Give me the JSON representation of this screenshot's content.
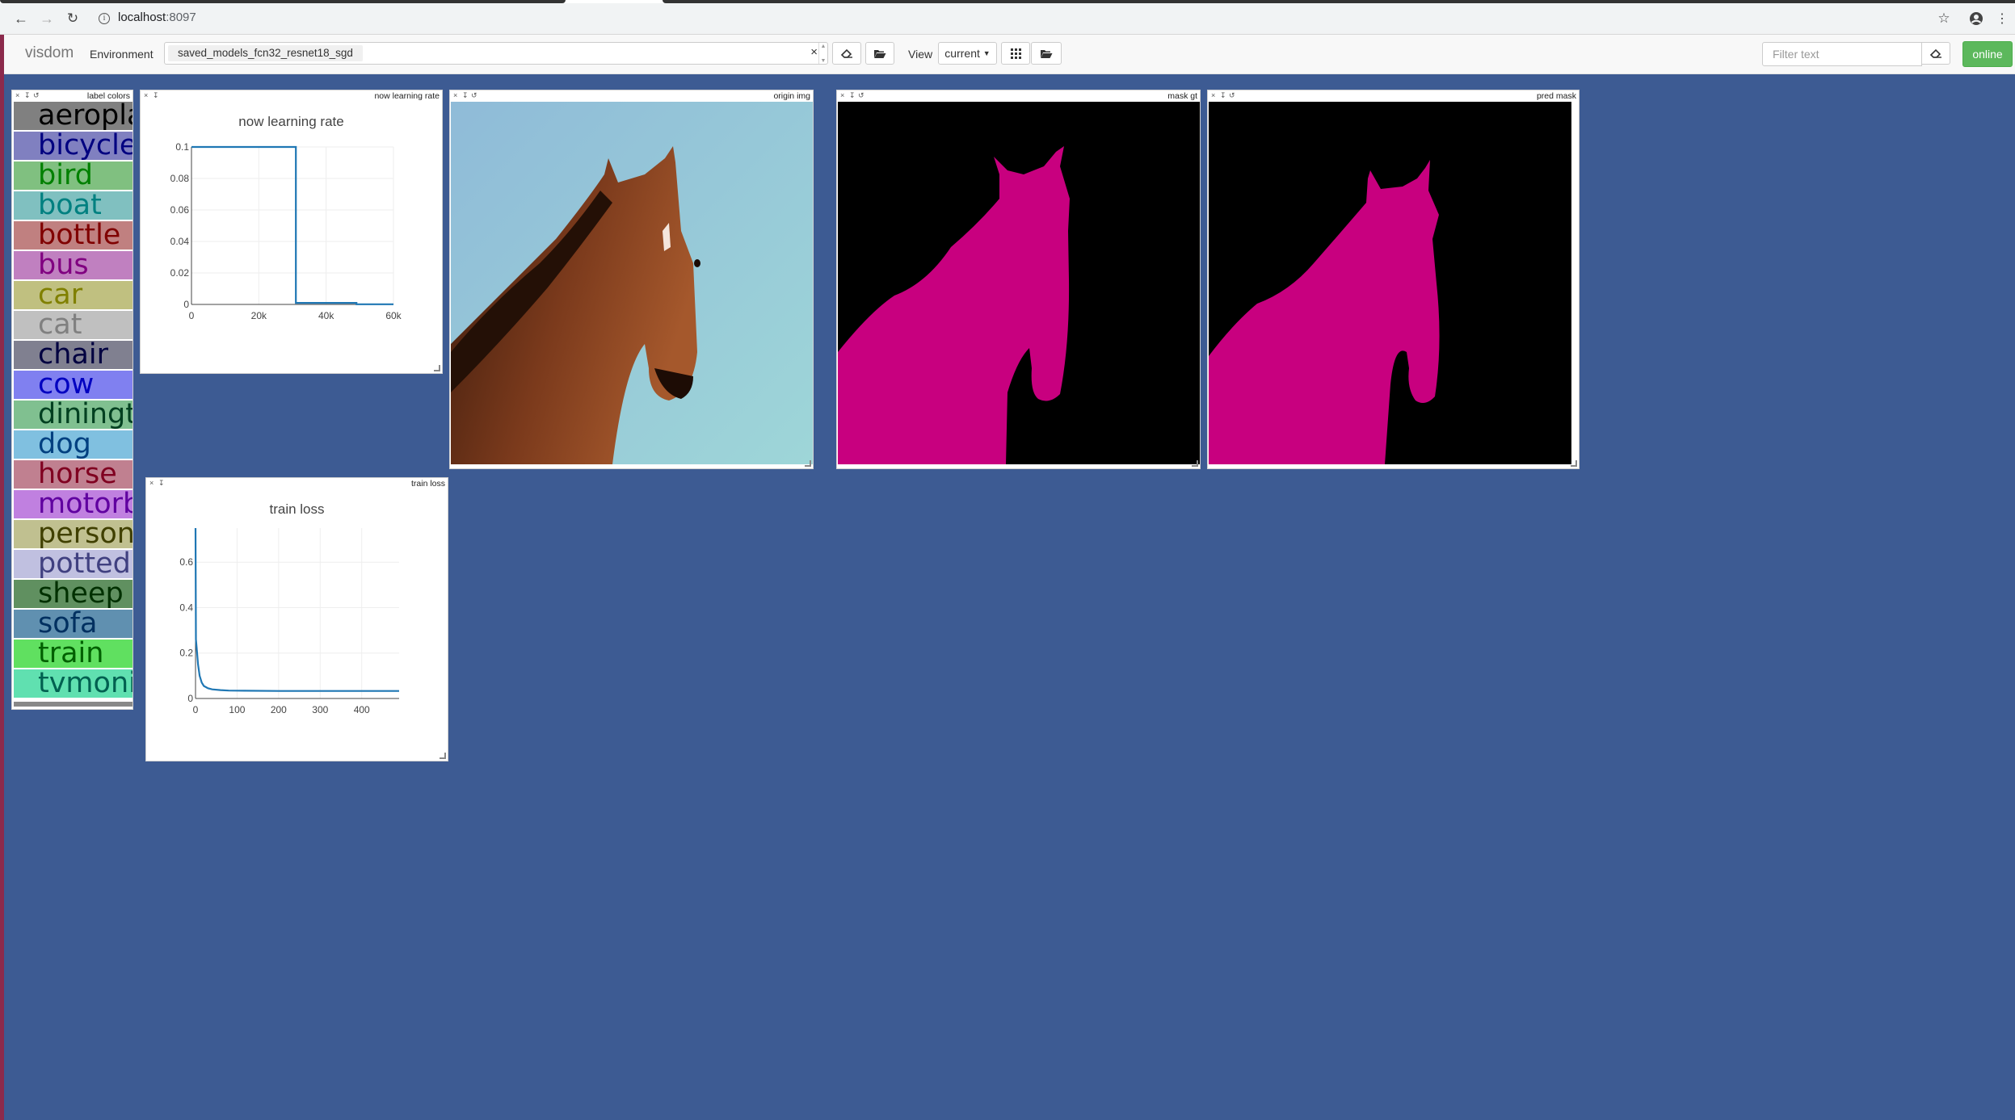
{
  "browser": {
    "url_host": "localhost",
    "url_port": ":8097"
  },
  "navbar": {
    "brand": "visdom",
    "environment_label": "Environment",
    "environment_value": "saved_models_fcn32_resnet18_sgd",
    "environment_clear": "×",
    "view_label": "View",
    "view_value": "current",
    "filter_placeholder": "Filter text",
    "status": "online"
  },
  "panes": {
    "label_colors": {
      "title": "label colors",
      "items": [
        {
          "label": "aeroplane",
          "bg": "#808080",
          "fg": "#000000"
        },
        {
          "label": "bicycle",
          "bg": "#8080c0",
          "fg": "#000080"
        },
        {
          "label": "bird",
          "bg": "#80c080",
          "fg": "#008000"
        },
        {
          "label": "boat",
          "bg": "#80c0c0",
          "fg": "#008080"
        },
        {
          "label": "bottle",
          "bg": "#c08080",
          "fg": "#800000"
        },
        {
          "label": "bus",
          "bg": "#c080c0",
          "fg": "#800080"
        },
        {
          "label": "car",
          "bg": "#c0c080",
          "fg": "#808000"
        },
        {
          "label": "cat",
          "bg": "#c0c0c0",
          "fg": "#808080"
        },
        {
          "label": "chair",
          "bg": "#808090",
          "fg": "#000040"
        },
        {
          "label": "cow",
          "bg": "#8080f0",
          "fg": "#0000c0"
        },
        {
          "label": "diningtable",
          "bg": "#80c090",
          "fg": "#004020"
        },
        {
          "label": "dog",
          "bg": "#80c0e0",
          "fg": "#004080"
        },
        {
          "label": "horse",
          "bg": "#c08090",
          "fg": "#800020"
        },
        {
          "label": "motorbike",
          "bg": "#c080e0",
          "fg": "#6000a0"
        },
        {
          "label": "person",
          "bg": "#c0c090",
          "fg": "#404000"
        },
        {
          "label": "pottedplant",
          "bg": "#c0c0e0",
          "fg": "#404080"
        },
        {
          "label": "sheep",
          "bg": "#609060",
          "fg": "#003000"
        },
        {
          "label": "sofa",
          "bg": "#6090b0",
          "fg": "#003060"
        },
        {
          "label": "train",
          "bg": "#60e060",
          "fg": "#006000"
        },
        {
          "label": "tvmonitor",
          "bg": "#60e0b0",
          "fg": "#006050"
        }
      ]
    },
    "learning_rate": {
      "title": "now learning rate",
      "plot_title": "now learning rate"
    },
    "origin_img": {
      "title": "origin img"
    },
    "mask_gt": {
      "title": "mask gt"
    },
    "pred_mask": {
      "title": "pred mask"
    },
    "train_loss": {
      "title": "train loss",
      "plot_title": "train loss"
    }
  },
  "chart_data": [
    {
      "type": "line",
      "title": "now learning rate",
      "xlabel": "",
      "ylabel": "",
      "xlim": [
        0,
        60000
      ],
      "ylim": [
        0,
        0.1
      ],
      "x_ticks": [
        "0",
        "20k",
        "40k",
        "60k"
      ],
      "y_ticks": [
        "0",
        "0.02",
        "0.04",
        "0.06",
        "0.08",
        "0.1"
      ],
      "grid": true,
      "series": [
        {
          "x": [
            0,
            31000,
            31000,
            49000,
            49000,
            60000
          ],
          "y": [
            0.1,
            0.1,
            0.001,
            0.001,
            0.0001,
            0.0001
          ]
        }
      ]
    },
    {
      "type": "line",
      "title": "train loss",
      "xlabel": "",
      "ylabel": "",
      "xlim": [
        0,
        490
      ],
      "ylim": [
        0,
        0.75
      ],
      "x_ticks": [
        "0",
        "100",
        "200",
        "300",
        "400"
      ],
      "y_ticks": [
        "0",
        "0.2",
        "0.4",
        "0.6"
      ],
      "grid": true,
      "series": [
        {
          "x": [
            0,
            1,
            3,
            6,
            10,
            15,
            20,
            30,
            40,
            60,
            80,
            120,
            200,
            300,
            400,
            490
          ],
          "y": [
            0.75,
            0.26,
            0.22,
            0.15,
            0.1,
            0.07,
            0.055,
            0.045,
            0.04,
            0.037,
            0.035,
            0.034,
            0.033,
            0.033,
            0.033,
            0.033
          ]
        }
      ]
    }
  ]
}
